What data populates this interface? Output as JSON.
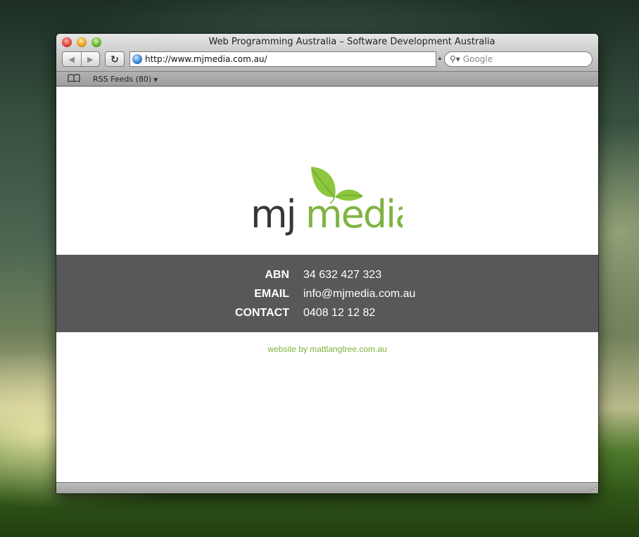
{
  "window": {
    "title": "Web Programming Australia – Software Development Australia"
  },
  "toolbar": {
    "back_icon": "back-arrow-icon",
    "forward_icon": "forward-arrow-icon",
    "reload_icon": "reload-icon",
    "url": "http://www.mjmedia.com.au/",
    "search_placeholder": "Google"
  },
  "bookmarks": {
    "book_icon": "bookmarks-book-icon",
    "rss_label": "RSS Feeds (80)"
  },
  "page": {
    "logo": {
      "mj": "mj",
      "media": "media",
      "mj_color": "#3a3536",
      "media_color": "#7fb342"
    },
    "info": [
      {
        "label": "ABN",
        "value": "34 632 427 323"
      },
      {
        "label": "EMAIL",
        "value": "info@mjmedia.com.au"
      },
      {
        "label": "CONTACT",
        "value": "0408 12 12 82"
      }
    ],
    "credit": "website by mattlangtree.com.au"
  },
  "colors": {
    "info_bar": "#58585a",
    "brand_green": "#7fb342",
    "credit_green": "#7db33a"
  }
}
